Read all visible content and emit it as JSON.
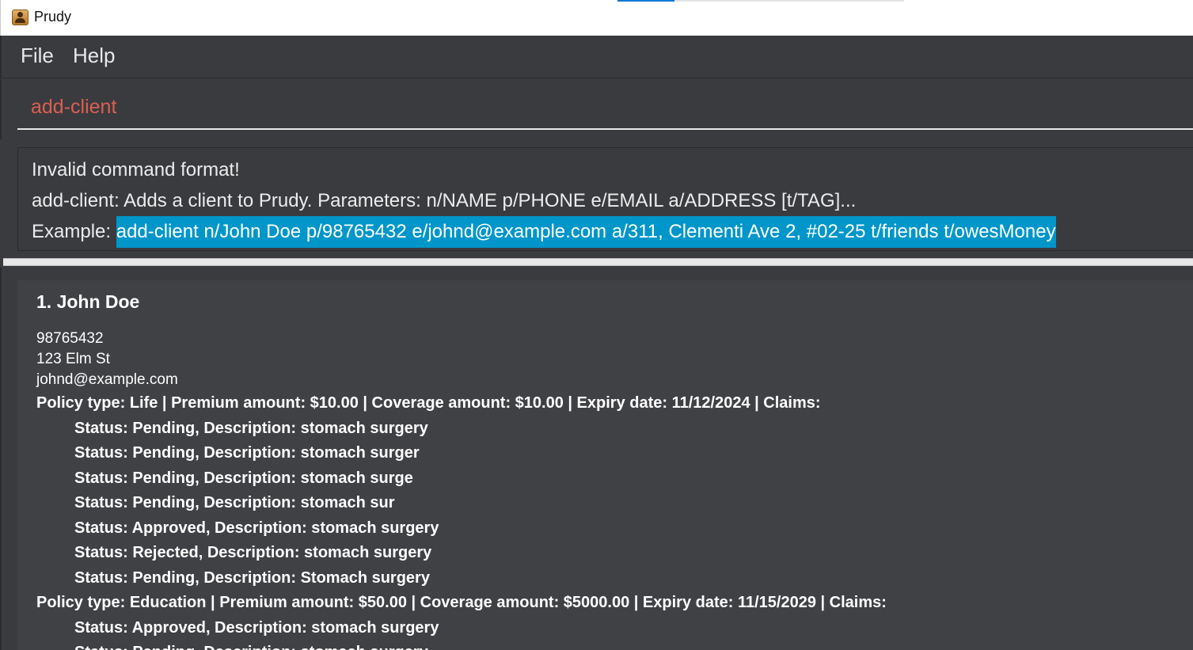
{
  "window": {
    "title": "Prudy",
    "icon": "app-contacts-icon"
  },
  "menu": {
    "items": [
      "File",
      "Help"
    ]
  },
  "command": {
    "value": "add-client"
  },
  "result": {
    "line1": "Invalid command format!",
    "line2": "add-client: Adds a client to Prudy. Parameters: n/NAME p/PHONE e/EMAIL a/ADDRESS [t/TAG]...",
    "line3_prefix": "Example: ",
    "line3_highlight": "add-client n/John Doe p/98765432 e/johnd@example.com a/311, Clementi Ave 2, #02-25 t/friends t/owesMoney"
  },
  "clients": [
    {
      "name": "1. John Doe",
      "phone": "98765432",
      "address": "123 Elm St",
      "email": "johnd@example.com",
      "policies": [
        {
          "header": "Policy type: Life | Premium amount: $10.00 | Coverage amount: $10.00 | Expiry date: 11/12/2024 | Claims:",
          "claims": [
            "Status: Pending, Description: stomach surgery",
            "Status: Pending, Description: stomach surger",
            "Status: Pending, Description: stomach surge",
            "Status: Pending, Description: stomach sur",
            "Status: Approved, Description: stomach surgery",
            "Status: Rejected, Description: stomach surgery",
            "Status: Pending, Description: Stomach surgery"
          ]
        },
        {
          "header": "Policy type: Education | Premium amount: $50.00 | Coverage amount: $5000.00 | Expiry date: 11/15/2029 | Claims:",
          "claims": [
            "Status: Approved, Description: stomach surgery",
            "Status: Pending, Description: stomach surgery"
          ]
        }
      ]
    }
  ],
  "colors": {
    "background": "#3a3b3f",
    "card": "#404145",
    "command_text": "#d9604f",
    "highlight": "#0096c9"
  }
}
